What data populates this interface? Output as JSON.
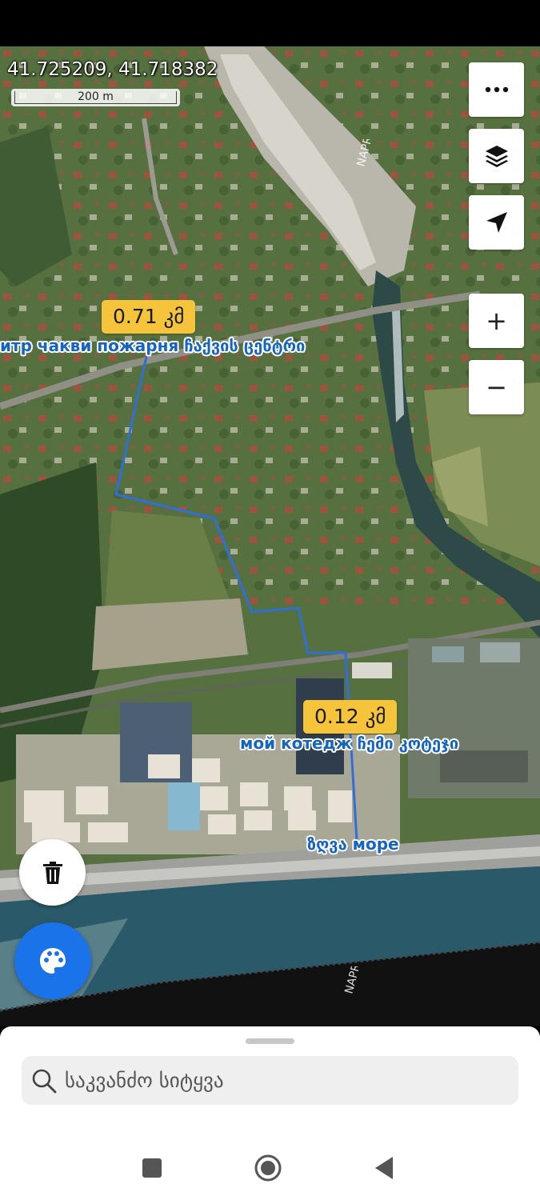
{
  "map": {
    "coordinates": "41.725209, 41.718382",
    "scale_label": "200 m",
    "watermark": "NAPR"
  },
  "controls": {
    "more_icon": "more-horizontal-icon",
    "layers_icon": "layers-icon",
    "locate_icon": "navigation-arrow-icon",
    "zoom_in_label": "+",
    "zoom_out_label": "−"
  },
  "route": {
    "color": "#2f6fd8",
    "segments": [
      {
        "distance": "0.71 კმ",
        "label": "итр чакви пожарня ჩაქვის ცენტრი"
      },
      {
        "distance": "0.12 კმ",
        "label": "мой котедж ჩემი კოტეჯი"
      }
    ],
    "destination_label": "ზღვა море"
  },
  "fab": {
    "delete_icon": "trash-icon",
    "palette_icon": "palette-icon",
    "palette_color": "#1a73e8"
  },
  "search": {
    "placeholder": "საკვანძო სიტყვა"
  },
  "nav": {
    "recents_icon": "square-icon",
    "home_icon": "circle-icon",
    "back_icon": "triangle-back-icon"
  }
}
